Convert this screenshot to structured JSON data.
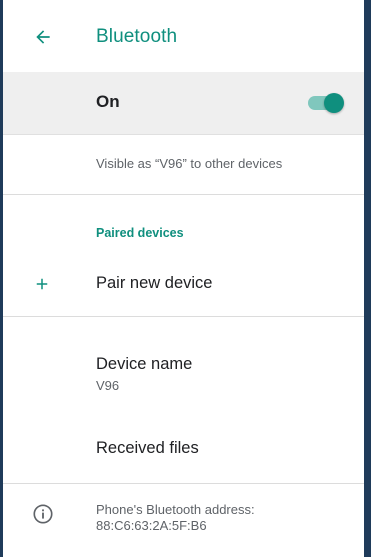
{
  "colors": {
    "accent": "#0f8f7e",
    "switch_track": "#80c7bd",
    "frame": "#1f3b5a"
  },
  "appbar": {
    "back_icon": "arrow-back-icon",
    "title": "Bluetooth"
  },
  "bluetooth_toggle": {
    "label": "On",
    "state": "on"
  },
  "visibility": {
    "text": "Visible as “V96” to other devices"
  },
  "paired_devices": {
    "header": "Paired devices",
    "pair_new": {
      "icon": "plus-icon",
      "label": "Pair new device"
    }
  },
  "device_name": {
    "title": "Device name",
    "value": "V96"
  },
  "received_files": {
    "label": "Received files"
  },
  "bluetooth_address": {
    "icon": "info-icon",
    "label": "Phone's Bluetooth address:",
    "value": "88:C6:63:2A:5F:B6"
  }
}
